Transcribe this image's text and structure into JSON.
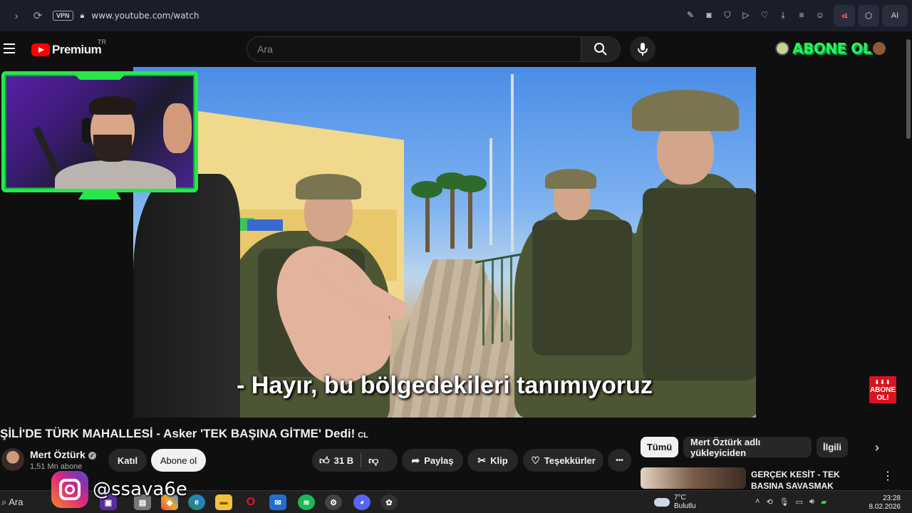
{
  "browser": {
    "vpn_label": "VPN",
    "url": "www.youtube.com/watch",
    "ai_label": "AI",
    "ext_badge": "1"
  },
  "header": {
    "brand": "Premium",
    "region": "TR",
    "search_placeholder": "Ara",
    "overlay_logo_text": "ABONE OL"
  },
  "video": {
    "subtitle": "- Hayır, bu bölgedekileri tanımıyoruz",
    "sticker_line1": "ABONE",
    "sticker_line2": "OL!"
  },
  "details": {
    "title": "ŞİLİ'DE TÜRK MAHALLESİ - Asker 'TEK BAŞINA GİTME' Dedi!",
    "title_badge": "CL",
    "channel_name": "Mert Öztürk",
    "subscribers": "1,51 Mn abone",
    "join_label": "Katıl",
    "subscribe_label": "Abone ol",
    "likes": "31 B",
    "share_label": "Paylaş",
    "clip_label": "Klip",
    "thanks_label": "Teşekkürler",
    "more_label": "•••"
  },
  "related": {
    "chips": [
      "Tümü",
      "Mert Öztürk adlı yükleyiciden",
      "İlgili"
    ],
    "rec_title": "GERÇEK KESİT - TEK BAŞINA SAVAŞMAK"
  },
  "overlay": {
    "instagram_handle": "@ssava6e"
  },
  "taskbar": {
    "search_label": "Ara",
    "temperature": "7°C",
    "weather": "Bulutlu",
    "time": "23:28",
    "date": "8.02.2026"
  },
  "colors": {
    "yt_red": "#ff0000",
    "webcam_frame": "#29e64a",
    "background": "#0f0f0f"
  }
}
